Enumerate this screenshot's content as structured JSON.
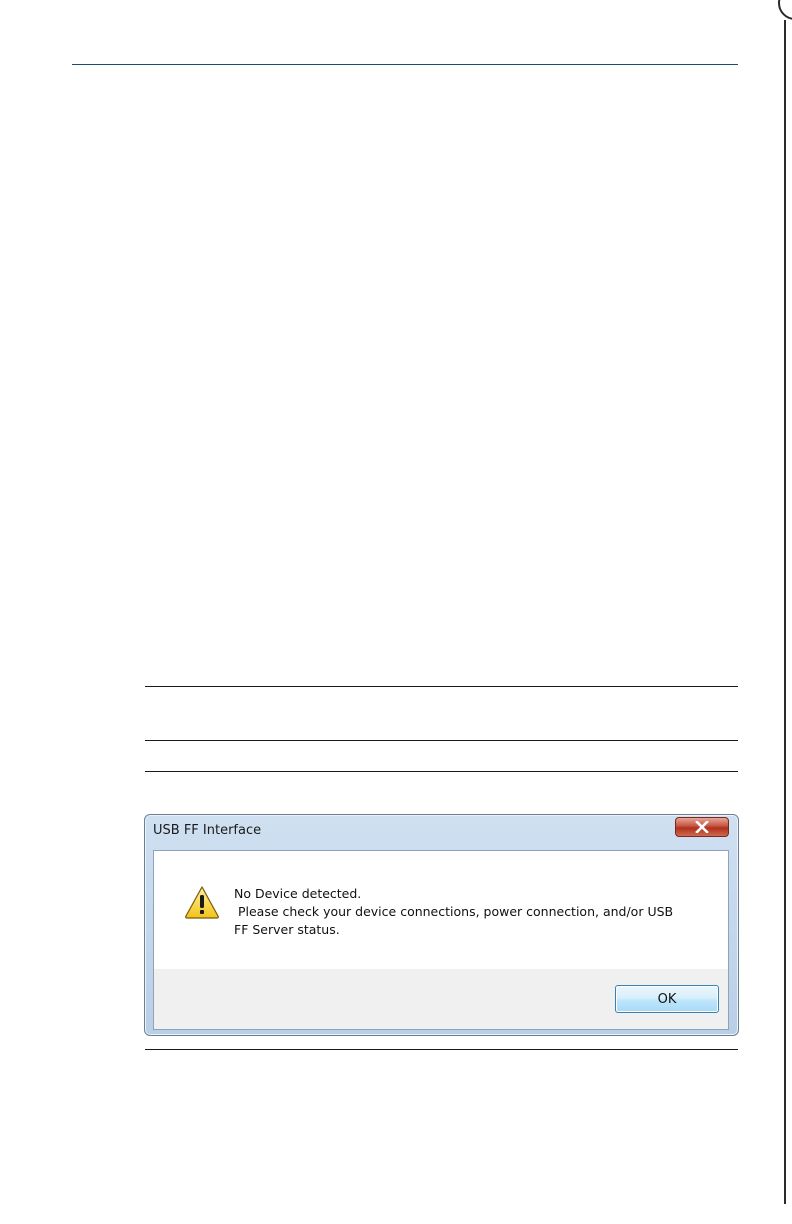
{
  "dialog": {
    "title": "USB FF Interface",
    "message_lines": [
      "No Device detected.",
      " Please check your device connections, power connection, and/or USB",
      "FF Server status."
    ],
    "ok_label": "OK",
    "icon": "warning-icon",
    "close_icon": "close-icon"
  }
}
